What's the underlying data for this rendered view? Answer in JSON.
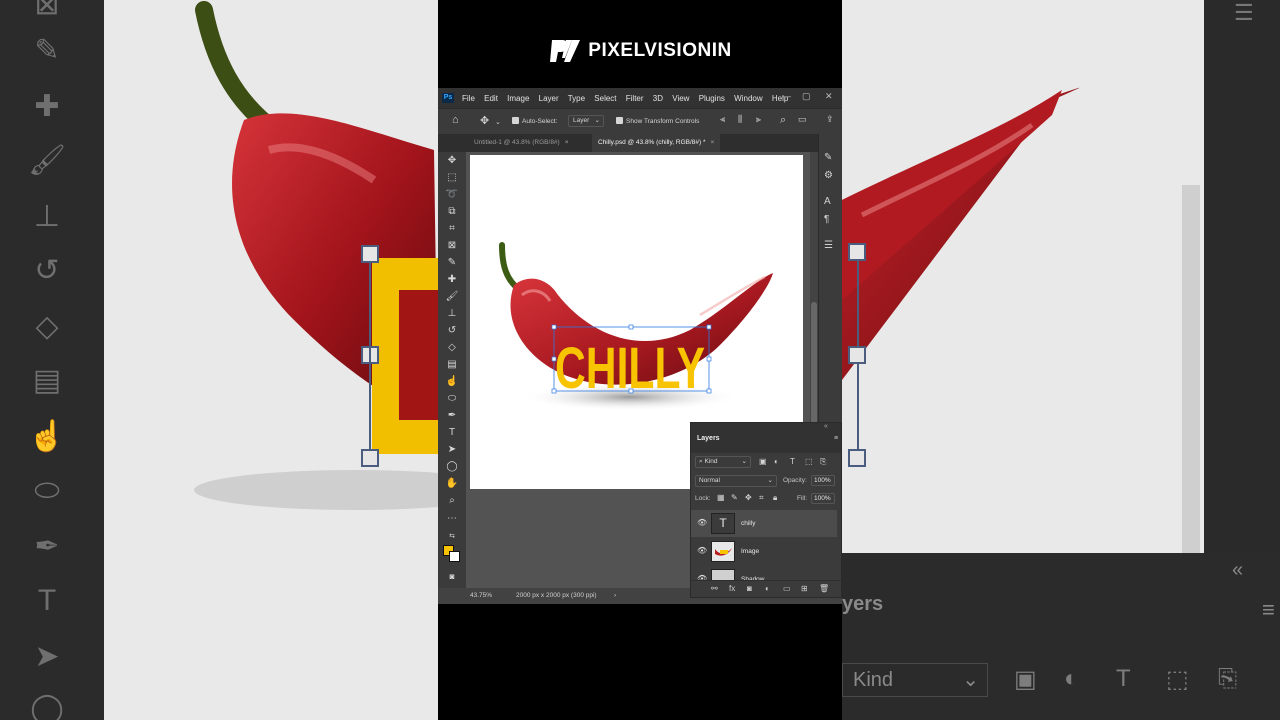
{
  "brand": {
    "name": "PIXELVISIONIN",
    "logo_icon": "pv-logo-icon"
  },
  "app": {
    "icon_text": "Ps",
    "menu": [
      "File",
      "Edit",
      "Image",
      "Layer",
      "Type",
      "Select",
      "Filter",
      "3D",
      "View",
      "Plugins",
      "Window",
      "Help"
    ],
    "window_controls": {
      "minimize": "—",
      "maximize": "▢",
      "close": "✕"
    }
  },
  "options_bar": {
    "auto_select_label": "Auto-Select:",
    "auto_select_value": "Layer",
    "transform_controls_label": "Show Transform Controls"
  },
  "tabs": [
    {
      "label": "Untitled-1 @ 43.8% (RGB/8#)",
      "close": "×"
    },
    {
      "label": "Chilly.psd @ 43.8% (chilly, RGB/8#) *",
      "close": "×"
    }
  ],
  "canvas": {
    "text_layer": "CHILLY",
    "text_color": "#f8c300",
    "pepper_color": "#b51f1f"
  },
  "status": {
    "zoom": "43.75%",
    "doc_size": "2000 px x 2000 px (300 ppi)",
    "arrow": "›"
  },
  "layers_panel": {
    "title": "Layers",
    "filter_kind": "Kind",
    "blend_mode": "Normal",
    "opacity_label": "Opacity:",
    "opacity_value": "100%",
    "lock_label": "Lock:",
    "fill_label": "Fill:",
    "fill_value": "100%",
    "layers": [
      {
        "name": "chilly",
        "type": "text",
        "thumb": "T"
      },
      {
        "name": "Image",
        "type": "image",
        "thumb": ""
      },
      {
        "name": "Shadow",
        "type": "group",
        "thumb": ""
      }
    ]
  },
  "background": {
    "right_panel_title": "yers",
    "right_kind_label": "Kind"
  },
  "colors": {
    "foreground": "#f8c300",
    "background": "#ffffff",
    "accent": "#31a8ff"
  }
}
